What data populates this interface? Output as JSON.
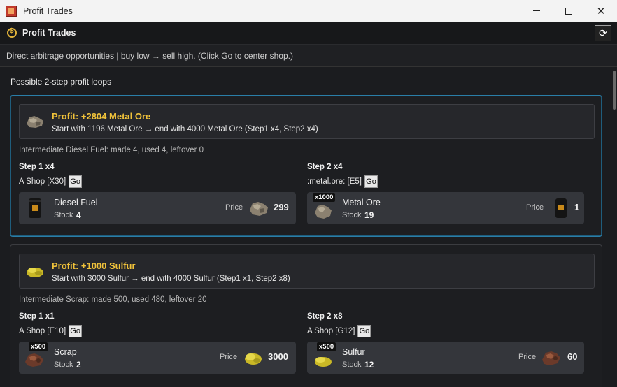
{
  "window": {
    "title": "Profit Trades"
  },
  "header": {
    "title": "Profit Trades"
  },
  "description": "Direct arbitrage opportunities | buy low → sell high. (Click Go to center shop.)",
  "section_title": "Possible 2-step profit loops",
  "go_label": "Go",
  "labels": {
    "stock": "Stock",
    "price": "Price"
  },
  "loops": [
    {
      "profit_title": "Profit: +2804 Metal Ore",
      "profit_desc": "Start with 1196 Metal Ore → end with 4000 Metal Ore (Step1 x4, Step2 x4)",
      "intermediate": "Intermediate Diesel Fuel: made 4, used 4, leftover 0",
      "steps": [
        {
          "label": "Step 1 x4",
          "shop": "A Shop [X30]",
          "item_name": "Diesel Fuel",
          "qty_badge": "",
          "stock": "4",
          "price": "299",
          "item_icon": "diesel-fuel-icon",
          "price_icon": "metal-ore-icon"
        },
        {
          "label": "Step 2 x4",
          "shop": ":metal.ore: [E5]",
          "item_name": "Metal Ore",
          "qty_badge": "x1000",
          "stock": "19",
          "price": "1",
          "item_icon": "metal-ore-icon",
          "price_icon": "diesel-fuel-icon"
        }
      ]
    },
    {
      "profit_title": "Profit: +1000 Sulfur",
      "profit_desc": "Start with 3000 Sulfur → end with 4000 Sulfur (Step1 x1, Step2 x8)",
      "intermediate": "Intermediate Scrap: made 500, used 480, leftover 20",
      "steps": [
        {
          "label": "Step 1 x1",
          "shop": "A Shop [E10]",
          "item_name": "Scrap",
          "qty_badge": "x500",
          "stock": "2",
          "price": "3000",
          "item_icon": "scrap-icon",
          "price_icon": "sulfur-icon"
        },
        {
          "label": "Step 2 x8",
          "shop": "A Shop [G12]",
          "item_name": "Sulfur",
          "qty_badge": "x500",
          "stock": "12",
          "price": "60",
          "item_icon": "sulfur-icon",
          "price_icon": "scrap-icon"
        }
      ]
    }
  ],
  "colors": {
    "profit": "#f0c23a",
    "selected_border": "#2a7ea8",
    "card_bg": "#34363b"
  }
}
